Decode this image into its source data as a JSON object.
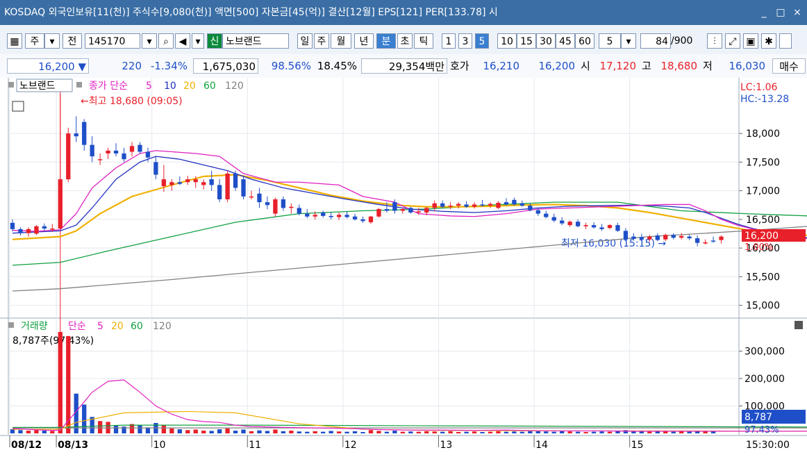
{
  "window": {
    "title": "KOSDAQ 외국인보유[11(천)] 주식수[9,080(천)] 액면[500] 자본금[45(억)] 결산[12월] EPS[121] PER[133.78] 시",
    "controls": [
      "_",
      "□",
      "×"
    ]
  },
  "toolbar": {
    "type_main": "주",
    "type_prev": "전",
    "code": "145170",
    "new_flag": "신",
    "stock_name": "노브랜드",
    "periods": [
      "일",
      "주",
      "월",
      "년",
      "분",
      "초",
      "틱"
    ],
    "active_period": "분",
    "intervals": [
      "1",
      "3",
      "5",
      "10",
      "15",
      "30",
      "45",
      "60"
    ],
    "active_interval": "5",
    "interval_select": "5",
    "count_current": "84",
    "count_max": "/900"
  },
  "quote": {
    "price": "16,200",
    "change_arrow": "▼",
    "change": "220",
    "change_pct": "-1.34%",
    "volume": "1,675,030",
    "vol_ratio": "98.56%",
    "turnover": "18.45%",
    "amount": "29,354백만",
    "hoga_label": "호가",
    "ask": "16,210",
    "bid": "16,200",
    "open_label": "시",
    "open": "17,120",
    "high_label": "고",
    "high": "18,680",
    "low_label": "저",
    "low": "16,030",
    "order_button": "매수"
  },
  "colors": {
    "up": "#e8202a",
    "down": "#1f4fc8",
    "ma5": "#e020c0",
    "ma10": "#2030c0",
    "ma20": "#f0b000",
    "ma60": "#10a040",
    "ma120": "#808080",
    "titlebar": "#3a6ea5"
  },
  "chart_data": [
    {
      "type": "candlestick",
      "title": "노브랜드",
      "legend": [
        "종가 단순",
        "5",
        "10",
        "20",
        "60",
        "120"
      ],
      "y_ticks": [
        "18,000",
        "17,500",
        "17,000",
        "16,500",
        "16,000",
        "15,500",
        "15,000"
      ],
      "ylim": [
        14850,
        18850
      ],
      "x_ticks": [
        "08/12",
        "08/13",
        "10",
        "11",
        "12",
        "13",
        "14",
        "15"
      ],
      "annotations": {
        "high": "←최고 18,680 (09:05)",
        "low": "최저 16,030 (15:15) →",
        "lc": "LC:1.06",
        "hc": "HC:-13.28",
        "current_price": "16,200",
        "current_pct": "1.00%"
      },
      "candles": [
        [
          16440,
          16500,
          16290,
          16330
        ],
        [
          16330,
          16360,
          16220,
          16260
        ],
        [
          16260,
          16360,
          16200,
          16330
        ],
        [
          16250,
          16400,
          16230,
          16380
        ],
        [
          16380,
          16430,
          16300,
          16340
        ],
        [
          16330,
          16420,
          16280,
          16340
        ],
        [
          16340,
          18680,
          16340,
          17200
        ],
        [
          17200,
          18100,
          17150,
          18000
        ],
        [
          18000,
          18300,
          17850,
          17950
        ],
        [
          18200,
          18250,
          17700,
          17800
        ],
        [
          17800,
          17950,
          17500,
          17600
        ],
        [
          17550,
          17650,
          17450,
          17550
        ],
        [
          17650,
          17750,
          17550,
          17700
        ],
        [
          17700,
          17830,
          17600,
          17650
        ],
        [
          17650,
          17750,
          17500,
          17550
        ],
        [
          17680,
          17850,
          17600,
          17780
        ],
        [
          17800,
          17850,
          17650,
          17680
        ],
        [
          17680,
          17750,
          17500,
          17580
        ],
        [
          17500,
          17600,
          17200,
          17280
        ],
        [
          17080,
          17450,
          16980,
          17200
        ],
        [
          17100,
          17200,
          17000,
          17150
        ],
        [
          17150,
          17250,
          17100,
          17120
        ],
        [
          17150,
          17260,
          17100,
          17200
        ],
        [
          17150,
          17250,
          17050,
          17200
        ],
        [
          17100,
          17200,
          17020,
          17150
        ],
        [
          17200,
          17350,
          17000,
          17100
        ],
        [
          17100,
          17200,
          16800,
          16850
        ],
        [
          16850,
          17350,
          16800,
          17300
        ],
        [
          17300,
          17350,
          17000,
          17050
        ],
        [
          17200,
          17250,
          16850,
          16900
        ],
        [
          16900,
          17000,
          16850,
          16900
        ],
        [
          16950,
          17050,
          16700,
          16800
        ],
        [
          16800,
          16900,
          16680,
          16750
        ],
        [
          16600,
          16880,
          16550,
          16850
        ],
        [
          16850,
          16900,
          16650,
          16700
        ],
        [
          16700,
          16780,
          16600,
          16720
        ],
        [
          16700,
          16760,
          16570,
          16600
        ],
        [
          16600,
          16680,
          16520,
          16550
        ],
        [
          16550,
          16640,
          16500,
          16580
        ],
        [
          16620,
          16650,
          16530,
          16560
        ],
        [
          16560,
          16620,
          16500,
          16540
        ],
        [
          16540,
          16620,
          16490,
          16580
        ],
        [
          16580,
          16640,
          16520,
          16540
        ],
        [
          16550,
          16600,
          16480,
          16500
        ],
        [
          16500,
          16550,
          16440,
          16470
        ],
        [
          16450,
          16560,
          16420,
          16550
        ],
        [
          16550,
          16700,
          16530,
          16680
        ],
        [
          16680,
          16800,
          16620,
          16650
        ],
        [
          16800,
          16850,
          16600,
          16650
        ],
        [
          16650,
          16700,
          16600,
          16680
        ],
        [
          16700,
          16720,
          16600,
          16620
        ],
        [
          16620,
          16700,
          16580,
          16640
        ],
        [
          16620,
          16720,
          16570,
          16700
        ],
        [
          16700,
          16830,
          16640,
          16780
        ],
        [
          16780,
          16830,
          16700,
          16720
        ],
        [
          16740,
          16800,
          16680,
          16740
        ],
        [
          16740,
          16800,
          16690,
          16770
        ],
        [
          16760,
          16820,
          16700,
          16720
        ],
        [
          16720,
          16800,
          16690,
          16760
        ],
        [
          16760,
          16840,
          16720,
          16740
        ],
        [
          16740,
          16800,
          16700,
          16770
        ],
        [
          16700,
          16820,
          16680,
          16790
        ],
        [
          16800,
          16870,
          16740,
          16760
        ],
        [
          16840,
          16880,
          16740,
          16760
        ],
        [
          16780,
          16830,
          16720,
          16740
        ],
        [
          16740,
          16780,
          16640,
          16660
        ],
        [
          16660,
          16700,
          16560,
          16600
        ],
        [
          16600,
          16650,
          16520,
          16540
        ],
        [
          16540,
          16600,
          16450,
          16480
        ],
        [
          16480,
          16540,
          16400,
          16430
        ],
        [
          16400,
          16480,
          16370,
          16460
        ],
        [
          16460,
          16500,
          16360,
          16380
        ],
        [
          16380,
          16440,
          16330,
          16400
        ],
        [
          16400,
          16450,
          16340,
          16360
        ],
        [
          16360,
          16420,
          16300,
          16330
        ],
        [
          16350,
          16420,
          16330,
          16400
        ],
        [
          16400,
          16440,
          16280,
          16300
        ],
        [
          16300,
          16350,
          16120,
          16150
        ],
        [
          16200,
          16260,
          16130,
          16160
        ],
        [
          16190,
          16250,
          16120,
          16150
        ],
        [
          16150,
          16230,
          16110,
          16200
        ],
        [
          16220,
          16260,
          16120,
          16140
        ],
        [
          16150,
          16250,
          16120,
          16230
        ],
        [
          16230,
          16260,
          16150,
          16180
        ],
        [
          16180,
          16260,
          16150,
          16210
        ],
        [
          16200,
          16240,
          16140,
          16170
        ],
        [
          16170,
          16220,
          16030,
          16090
        ],
        [
          16080,
          16150,
          16060,
          16100
        ],
        [
          16130,
          16200,
          16090,
          16120
        ],
        [
          16140,
          16220,
          16080,
          16200
        ]
      ],
      "ma": {
        "ma5": [
          [
            16310,
            16290,
            16320,
            16600,
            17050,
            17400,
            17650,
            17700,
            17680,
            17650,
            17600,
            17300,
            17150,
            17150,
            17100,
            16900,
            16800,
            16600,
            16560,
            16550,
            16600,
            16680,
            16700,
            16720,
            16740,
            16760,
            16760,
            16650,
            16500,
            16400,
            16330,
            16260,
            16190,
            16160,
            16180,
            16170
          ]
        ],
        "ma5_x": [
          0,
          3,
          6,
          8,
          10,
          13,
          16,
          18,
          20,
          23,
          26,
          29,
          33,
          36,
          41,
          44,
          48,
          51,
          55,
          58,
          62,
          66,
          70,
          74,
          78,
          82,
          85,
          87,
          89,
          91,
          93,
          95,
          97,
          99,
          101,
          103
        ],
        "ma10_x": [
          0,
          3,
          6,
          8,
          10,
          13,
          16,
          18,
          21,
          24,
          27,
          30,
          34,
          38,
          42,
          46,
          50,
          54,
          58,
          62,
          66,
          70,
          74,
          78,
          82,
          85,
          87,
          89,
          91,
          93,
          95,
          97,
          99,
          101,
          103
        ],
        "ma10": [
          16260,
          16280,
          16300,
          16400,
          16700,
          17200,
          17500,
          17600,
          17550,
          17450,
          17350,
          17200,
          17050,
          16950,
          16850,
          16760,
          16680,
          16640,
          16620,
          16650,
          16700,
          16730,
          16740,
          16750,
          16730,
          16700,
          16620,
          16520,
          16420,
          16340,
          16280,
          16230,
          16190,
          16170,
          16160
        ],
        "ma20_x": [
          0,
          6,
          8,
          11,
          15,
          20,
          24,
          28,
          32,
          36,
          40,
          44,
          48,
          52,
          56,
          60,
          64,
          68,
          72,
          76,
          80,
          84,
          88,
          92,
          96,
          100,
          103
        ],
        "ma20": [
          16150,
          16200,
          16300,
          16600,
          16900,
          17100,
          17250,
          17280,
          17180,
          17050,
          16920,
          16820,
          16750,
          16720,
          16720,
          16730,
          16750,
          16760,
          16740,
          16700,
          16620,
          16520,
          16420,
          16320,
          16260,
          16220,
          16190
        ],
        "ma60_x": [
          0,
          6,
          12,
          20,
          28,
          36,
          44,
          52,
          60,
          68,
          76,
          84,
          92,
          100,
          103
        ],
        "ma60": [
          15700,
          15750,
          15950,
          16200,
          16450,
          16600,
          16650,
          16680,
          16750,
          16800,
          16800,
          16650,
          16600,
          16560,
          16540
        ],
        "ma120_x": [
          0,
          6,
          20,
          36,
          52,
          68,
          80,
          92,
          100,
          103
        ],
        "ma120": [
          15250,
          15290,
          15450,
          15650,
          15850,
          16050,
          16200,
          16300,
          16380,
          16420
        ]
      }
    },
    {
      "type": "bar",
      "title": "거래량",
      "legend": [
        "거래량",
        "단순",
        "5",
        "20",
        "60",
        "120"
      ],
      "current_label": "8,787주(97.43%)",
      "y_ticks": [
        "300,000",
        "200,000",
        "100,000"
      ],
      "ylim": [
        0,
        385000
      ],
      "annotations": {
        "current_volume": "8,787",
        "current_pct": "97.43%"
      },
      "values": [
        15000,
        12000,
        10000,
        12000,
        10000,
        9000,
        370000,
        355000,
        145000,
        105000,
        60000,
        45000,
        42000,
        30000,
        25000,
        34000,
        30000,
        22000,
        38000,
        30000,
        18000,
        15000,
        12000,
        14000,
        10000,
        9000,
        15000,
        18000,
        10000,
        14000,
        8000,
        11000,
        9000,
        14000,
        8000,
        10000,
        7000,
        6000,
        8000,
        6000,
        9000,
        7000,
        6000,
        8000,
        5000,
        12000,
        9000,
        6000,
        10000,
        6000,
        7000,
        6000,
        8000,
        7000,
        6000,
        8000,
        5000,
        6000,
        7000,
        5000,
        6000,
        8000,
        6000,
        7000,
        6000,
        9000,
        8000,
        7000,
        6000,
        8000,
        7000,
        6000,
        5000,
        6000,
        7000,
        6000,
        9000,
        12000,
        8000,
        7000,
        6000,
        8000,
        7000,
        6000,
        9000,
        6000,
        7000,
        8000,
        8787
      ],
      "ma5": [
        18000,
        13000,
        11000,
        12000,
        80000,
        150000,
        190000,
        195000,
        150000,
        100000,
        70000,
        50000,
        43000,
        40000,
        30000,
        25000,
        22000,
        20000,
        18000,
        14000,
        12000,
        12000,
        11000,
        12000,
        10000,
        9000,
        9000,
        8000,
        8000,
        8000,
        8000,
        8000,
        8000,
        8000,
        8000,
        8000
      ],
      "ma5_x": [
        0,
        3,
        5,
        6,
        8,
        10,
        12,
        14,
        16,
        18,
        20,
        22,
        24,
        26,
        28,
        30,
        34,
        38,
        42,
        46,
        50,
        54,
        58,
        62,
        66,
        70,
        74,
        78,
        82,
        86,
        90,
        94,
        98,
        100,
        102,
        103
      ],
      "ma20_x": [
        0,
        6,
        8,
        14,
        22,
        28,
        36,
        44,
        52,
        60,
        68,
        76,
        84,
        92,
        100,
        103
      ],
      "ma20": [
        15000,
        15000,
        40000,
        75000,
        80000,
        75000,
        35000,
        15000,
        11000,
        10000,
        9000,
        9000,
        9000,
        8000,
        8000,
        8000
      ],
      "ma60_x": [
        0,
        6,
        14,
        30,
        50,
        70,
        90,
        103
      ],
      "ma60": [
        22000,
        22000,
        30000,
        30000,
        28000,
        26000,
        24000,
        23000
      ],
      "ma120_x": [
        0,
        10,
        40,
        80,
        103
      ],
      "ma120": [
        20000,
        20000,
        20000,
        20000,
        20000
      ]
    }
  ],
  "x_axis": [
    "08/12",
    "08/13",
    "10",
    "11",
    "12",
    "13",
    "14",
    "15"
  ],
  "time_label": "15:30:00"
}
